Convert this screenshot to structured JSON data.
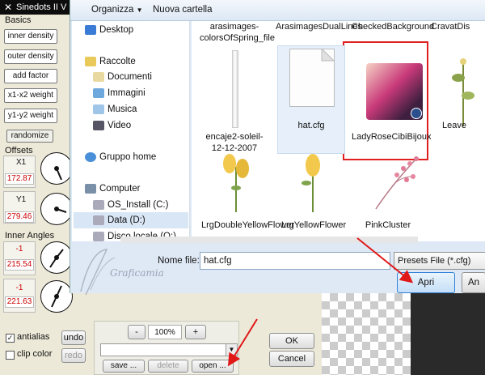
{
  "plugin": {
    "title": "Sinedots II V",
    "section_basics": "Basics",
    "basic_buttons": [
      "inner density",
      "outer density",
      "add factor",
      "x1-x2 weight",
      "y1-y2 weight"
    ],
    "randomize": "randomize",
    "section_offsets": "Offsets",
    "x1_label": "X1",
    "x1_value": "172.87",
    "y1_label": "Y1",
    "y1_value": "279.46",
    "section_inner_angles": "Inner Angles",
    "angle1_top": "-1",
    "angle1_value": "215.54",
    "angle2_top": "-1",
    "angle2_value": "221.63",
    "antialias": "antialias",
    "clip_color": "clip color",
    "undo": "undo",
    "redo": "redo",
    "zoom_minus": "-",
    "zoom_value": "100%",
    "zoom_plus": "+",
    "save": "save ...",
    "delete": "delete",
    "open": "open ...",
    "ok": "OK",
    "cancel": "Cancel",
    "watermark": "Graficamia"
  },
  "dialog": {
    "organize": "Organizza",
    "new_folder": "Nuova cartella",
    "nav": {
      "desktop": "Desktop",
      "raccolte": "Raccolte",
      "documenti": "Documenti",
      "immagini": "Immagini",
      "musica": "Musica",
      "video": "Video",
      "gruppo_home": "Gruppo home",
      "computer": "Computer",
      "os_install": "OS_Install (C:)",
      "data": "Data (D:)",
      "disco": "Disco locale (Q:)"
    },
    "files": {
      "f1": "arasimages-colorsOfSpring_file",
      "f2": "ArasimagesDualLines",
      "f3": "CheckedBackground",
      "f4": "CravatDis",
      "f5": "encaje2-soleil-12-12-2007",
      "f6": "hat.cfg",
      "f7": "LadyRoseCibiBijoux",
      "f8": "Leave",
      "f9": "LrgDoubleYellowFlower",
      "f10": "LrgYellowFlower",
      "f11": "PinkCluster"
    },
    "filename_label": "Nome file:",
    "filename_value": "hat.cfg",
    "filetype": "Presets File (*.cfg)",
    "open_button": "Apri",
    "cancel_button": "An"
  },
  "colors": {
    "highlight_red": "#e02020",
    "arrow_red": "#e01818",
    "value_red": "#cc0000"
  }
}
